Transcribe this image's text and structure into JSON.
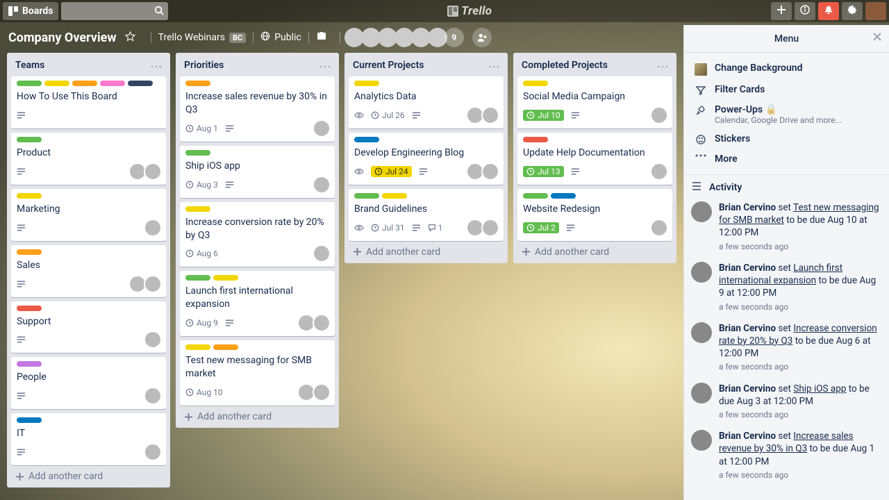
{
  "topbar": {
    "boards_label": "Boards",
    "search_placeholder": "",
    "brand": "Trello"
  },
  "board_header": {
    "title": "Company Overview",
    "team_name": "Trello Webinars",
    "team_badge": "BC",
    "visibility": "Public",
    "member_overflow": "9"
  },
  "lists": [
    {
      "name": "Teams",
      "cards": [
        {
          "labels": [
            "green",
            "yellow",
            "orange",
            "pink",
            "black"
          ],
          "title": "How To Use This Board",
          "badges": {
            "desc": true
          },
          "members": []
        },
        {
          "labels": [
            "green"
          ],
          "title": "Product",
          "badges": {
            "desc": true
          },
          "members": [
            "av1",
            "av2"
          ]
        },
        {
          "labels": [
            "yellow"
          ],
          "title": "Marketing",
          "badges": {
            "desc": true
          },
          "members": [
            "av3"
          ]
        },
        {
          "labels": [
            "orange"
          ],
          "title": "Sales",
          "badges": {
            "desc": true
          },
          "members": [
            "av1",
            "av2"
          ]
        },
        {
          "labels": [
            "red"
          ],
          "title": "Support",
          "badges": {
            "desc": true
          },
          "members": [
            "av4"
          ]
        },
        {
          "labels": [
            "purple"
          ],
          "title": "People",
          "badges": {
            "desc": true
          },
          "members": [
            "av5"
          ]
        },
        {
          "labels": [
            "blue"
          ],
          "title": "IT",
          "badges": {
            "desc": true
          },
          "members": [
            "av3"
          ]
        }
      ],
      "add": "Add another card"
    },
    {
      "name": "Priorities",
      "cards": [
        {
          "labels": [
            "orange"
          ],
          "title": "Increase sales revenue by 30% in Q3",
          "badges": {
            "due": "Aug 1",
            "desc": true
          },
          "members": [
            "av2"
          ]
        },
        {
          "labels": [
            "green"
          ],
          "title": "Ship iOS app",
          "badges": {
            "due": "Aug 3",
            "desc": true
          },
          "members": [
            "av1"
          ]
        },
        {
          "labels": [
            "yellow"
          ],
          "title": "Increase conversion rate by 20% by Q3",
          "badges": {
            "due": "Aug 6"
          },
          "members": [
            "av3"
          ]
        },
        {
          "labels": [
            "green",
            "yellow"
          ],
          "title": "Launch first international expansion",
          "badges": {
            "due": "Aug 9",
            "desc": true
          },
          "members": [
            "av3",
            "av1"
          ]
        },
        {
          "labels": [
            "yellow",
            "orange"
          ],
          "title": "Test new messaging for SMB market",
          "badges": {
            "due": "Aug 10"
          },
          "members": [
            "av3",
            "av2"
          ]
        }
      ],
      "add": "Add another card"
    },
    {
      "name": "Current Projects",
      "cards": [
        {
          "labels": [
            "yellow"
          ],
          "title": "Analytics Data",
          "badges": {
            "eye": true,
            "due": "Jul 26",
            "desc": true
          },
          "members": [
            "av3",
            "av1"
          ]
        },
        {
          "labels": [
            "blue"
          ],
          "title": "Develop Engineering Blog",
          "badges": {
            "eye": true,
            "due": "Jul 24",
            "due_style": "yellow",
            "desc": true
          },
          "members": [
            "av1",
            "av3"
          ]
        },
        {
          "labels": [
            "green",
            "yellow"
          ],
          "title": "Brand Guidelines",
          "badges": {
            "eye": true,
            "due": "Jul 31",
            "desc": true,
            "comments": "1"
          },
          "members": [
            "av1",
            "av3"
          ]
        }
      ],
      "add": "Add another card"
    },
    {
      "name": "Completed Projects",
      "cards": [
        {
          "labels": [
            "yellow"
          ],
          "title": "Social Media Campaign",
          "badges": {
            "due": "Jul 10",
            "due_style": "green",
            "desc": true
          },
          "members": [
            "av1"
          ]
        },
        {
          "labels": [
            "red"
          ],
          "title": "Update Help Documentation",
          "badges": {
            "due": "Jul 13",
            "due_style": "green",
            "desc": true
          },
          "members": [
            "av4"
          ]
        },
        {
          "labels": [
            "green",
            "blue"
          ],
          "title": "Website Redesign",
          "badges": {
            "due": "Jul 2",
            "due_style": "green",
            "desc": true
          },
          "members": [
            "av3"
          ]
        }
      ],
      "add": "Add another card"
    }
  ],
  "menu": {
    "title": "Menu",
    "items": {
      "change_bg": "Change Background",
      "filter": "Filter Cards",
      "powerups": "Power-Ups",
      "powerups_sub": "Calendar, Google Drive and more...",
      "stickers": "Stickers",
      "more": "More"
    },
    "activity_label": "Activity",
    "activity": [
      {
        "user": "Brian Cervino",
        "verb": "set",
        "link": "Test new messaging for SMB market",
        "tail": " to be due Aug 10 at 12:00 PM",
        "when": "a few seconds ago"
      },
      {
        "user": "Brian Cervino",
        "verb": "set",
        "link": "Launch first international expansion",
        "tail": " to be due Aug 9 at 12:00 PM",
        "when": "a few seconds ago"
      },
      {
        "user": "Brian Cervino",
        "verb": "set",
        "link": "Increase conversion rate by 20% by Q3",
        "tail": " to be due Aug 6 at 12:00 PM",
        "when": "a few seconds ago"
      },
      {
        "user": "Brian Cervino",
        "verb": "set",
        "link": "Ship iOS app",
        "tail": " to be due Aug 3 at 12:00 PM",
        "when": "a few seconds ago"
      },
      {
        "user": "Brian Cervino",
        "verb": "set",
        "link": "Increase sales revenue by 30% in Q3",
        "tail": " to be due Aug 1 at 12:00 PM",
        "when": "a few seconds ago"
      }
    ]
  }
}
